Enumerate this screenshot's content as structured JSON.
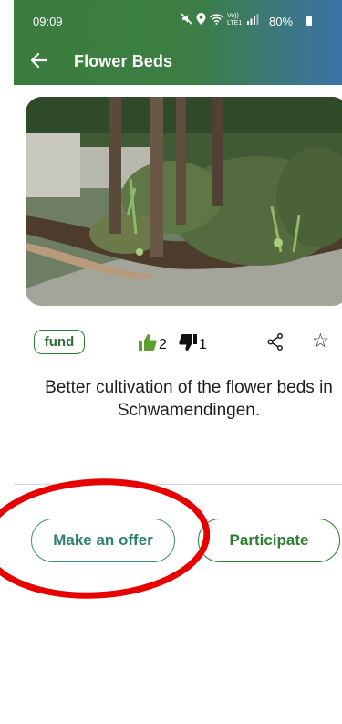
{
  "status_bar": {
    "time": "09:09",
    "network": "Vo)) LTE1",
    "battery": "80%"
  },
  "app_bar": {
    "title": "Flower Beds",
    "back_icon": "arrow-left-icon"
  },
  "project": {
    "image_alt": "flower bed photo",
    "tag": "fund",
    "upvotes": "2",
    "downvotes": "1",
    "description": "Better cultivation of the flower beds in Schwamendingen."
  },
  "actions": {
    "make_offer": "Make an offer",
    "participate": "Participate"
  },
  "colors": {
    "primary_green": "#2f7d32",
    "teal": "#3b8f80",
    "annotation_red": "#e60000"
  }
}
